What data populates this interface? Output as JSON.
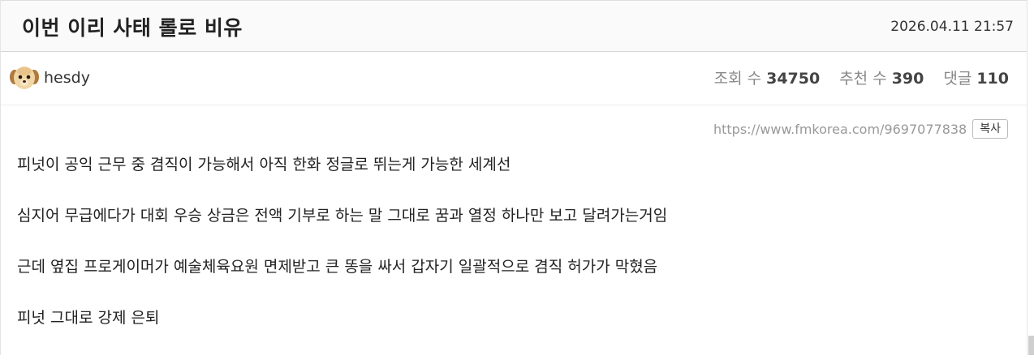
{
  "post": {
    "title": "이번 이리 사태 롤로 비유",
    "date": "2026.04.11 21:57",
    "author": "hesdy",
    "stats": {
      "views_label": "조회 수",
      "views_value": "34750",
      "recommend_label": "추천 수",
      "recommend_value": "390",
      "comments_label": "댓글",
      "comments_value": "110"
    },
    "url": "https://www.fmkorea.com/9697077838",
    "copy_label": "복사",
    "paragraphs": [
      "피넛이 공익 근무 중 겸직이 가능해서 아직 한화 정글로 뛰는게 가능한 세계선",
      "심지어 무급에다가 대회 우승 상금은 전액 기부로 하는 말 그대로 꿈과 열정 하나만 보고 달려가는거임",
      "근데 옆집 프로게이머가 예술체육요원 면제받고 큰 똥을 싸서 갑자기 일괄적으로 겸직 허가가 막혔음",
      "피넛 그대로 강제 은퇴"
    ]
  },
  "icons": {
    "avatar": "puppy-avatar"
  }
}
